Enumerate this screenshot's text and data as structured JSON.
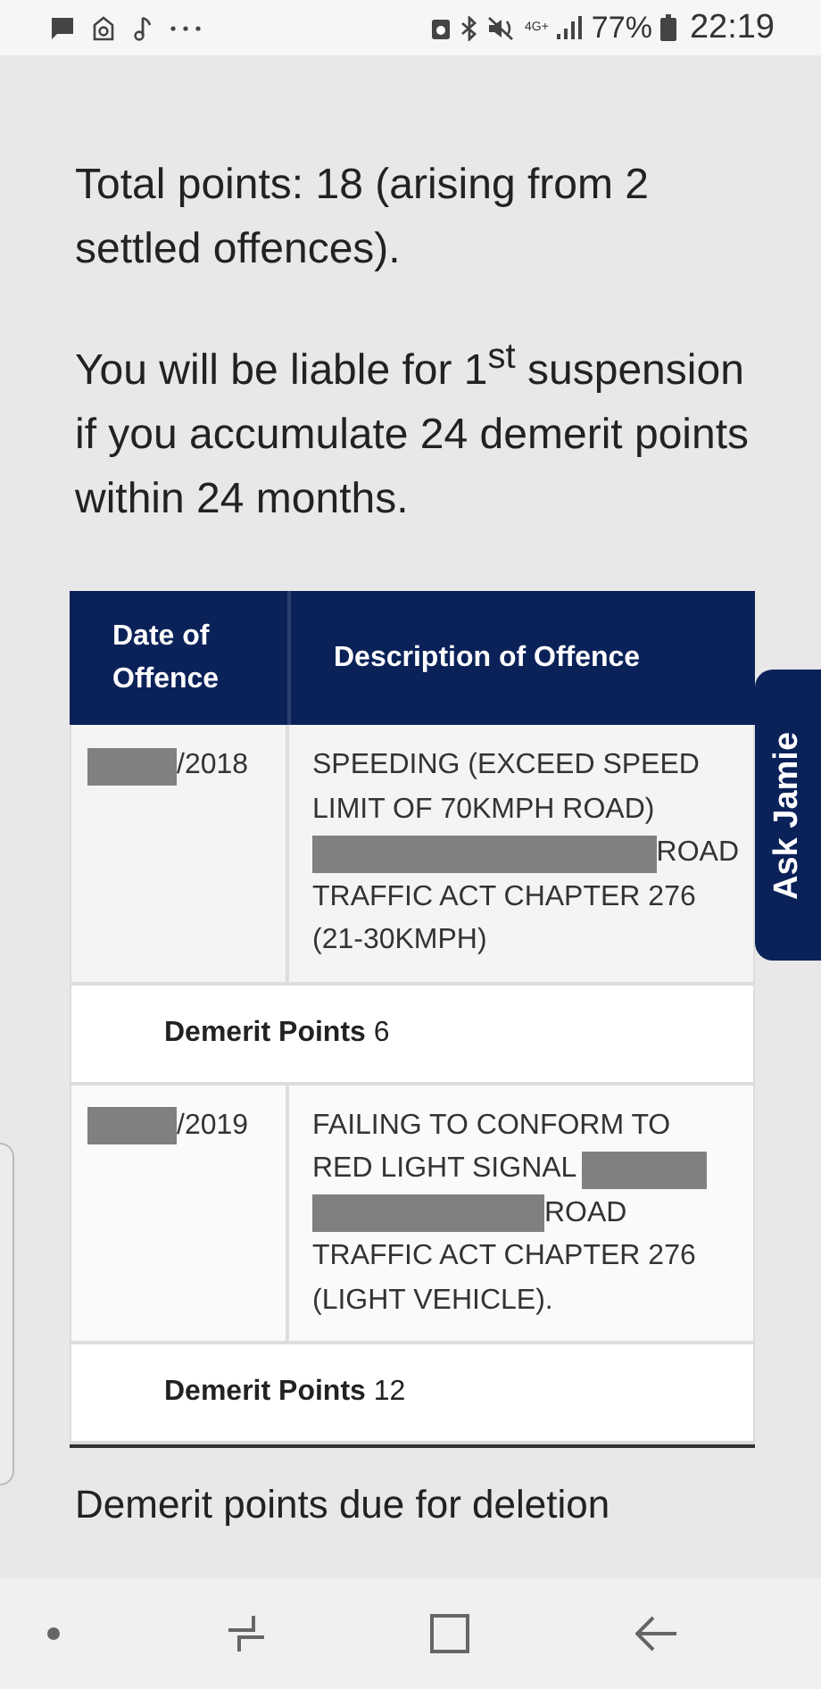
{
  "status_bar": {
    "network": "4G+",
    "battery": "77%",
    "time": "22:19"
  },
  "paragraphs": [
    "Total points: 18 (arising from 2 settled offences).",
    "You will be liable for 1$^{st}$ suspension if you accumulate 24 demerit points within 24 months."
  ],
  "table": {
    "columns": [
      "Date of Offence",
      "Description of Offence"
    ],
    "rows": [
      {
        "date": "/2018",
        "description_lines": [
          [
            {
              "kind": "text",
              "text": "SPEEDING (EXCEED SPEED"
            }
          ],
          [
            {
              "kind": "text",
              "text": "LIMIT OF 70KMPH ROAD)"
            }
          ],
          [
            {
              "kind": "redacted"
            },
            {
              "kind": "text",
              "text": "ROAD"
            }
          ],
          [
            {
              "kind": "text",
              "text": "TRAFFIC ACT CHAPTER 276"
            }
          ],
          [
            {
              "kind": "text",
              "text": "(21-30KMPH)"
            }
          ]
        ],
        "points_label": "Demerit Points",
        "points": "6"
      },
      {
        "date": "/2019",
        "description_lines": [
          [
            {
              "kind": "text",
              "text": "FAILING TO CONFORM TO"
            }
          ],
          [
            {
              "kind": "text",
              "text": "RED LIGHT SIGNAL"
            },
            {
              "kind": "redacted"
            }
          ],
          [
            {
              "kind": "redacted"
            },
            {
              "kind": "text",
              "text": "ROAD"
            }
          ],
          [
            {
              "kind": "text",
              "text": "TRAFFIC ACT CHAPTER 276"
            }
          ],
          [
            {
              "kind": "text",
              "text": "(LIGHT VEHICLE)."
            }
          ]
        ],
        "points_label": "Demerit Points",
        "points": "12"
      }
    ]
  },
  "next_heading": "Demerit points due for deletion",
  "chat_tab": "Ask Jamie"
}
